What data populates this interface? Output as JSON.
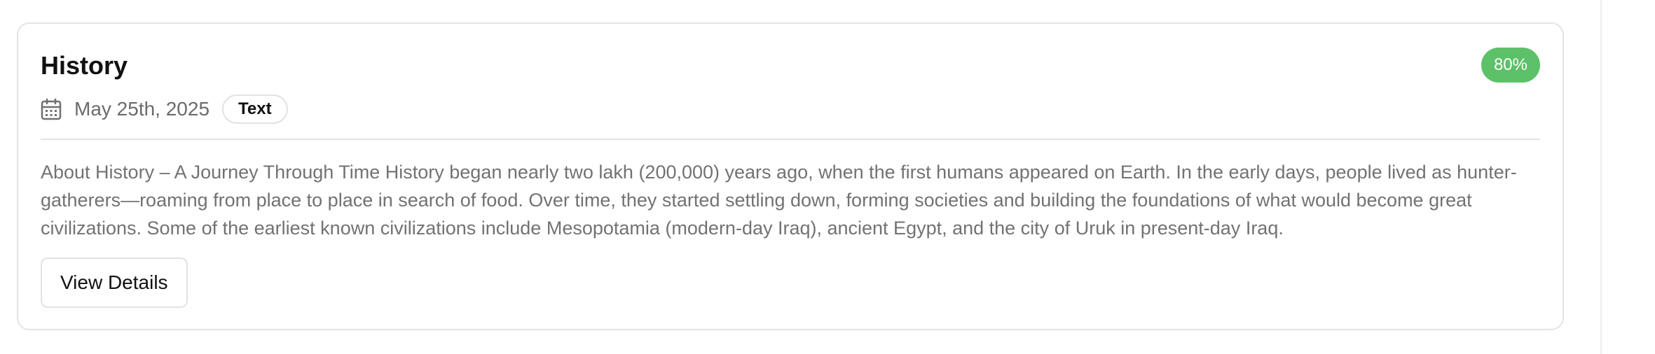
{
  "card": {
    "title": "History",
    "score": "80%",
    "date": "May 25th, 2025",
    "type": "Text",
    "description": "About History – A Journey Through Time History began nearly two lakh (200,000) years ago, when the first humans appeared on Earth. In the early days, people lived as hunter-gatherers—roaming from place to place in search of food. Over time, they started settling down, forming societies and building the foundations of what would become great civilizations. Some of the earliest known civilizations include Mesopotamia (modern-day Iraq), ancient Egypt, and the city of Uruk in present-day Iraq.",
    "button_label": "View Details"
  },
  "colors": {
    "score_badge": "#5cc168",
    "border": "#e4e4e7",
    "muted_text": "#6b6b6b"
  },
  "icons": {
    "date": "calendar-icon"
  }
}
